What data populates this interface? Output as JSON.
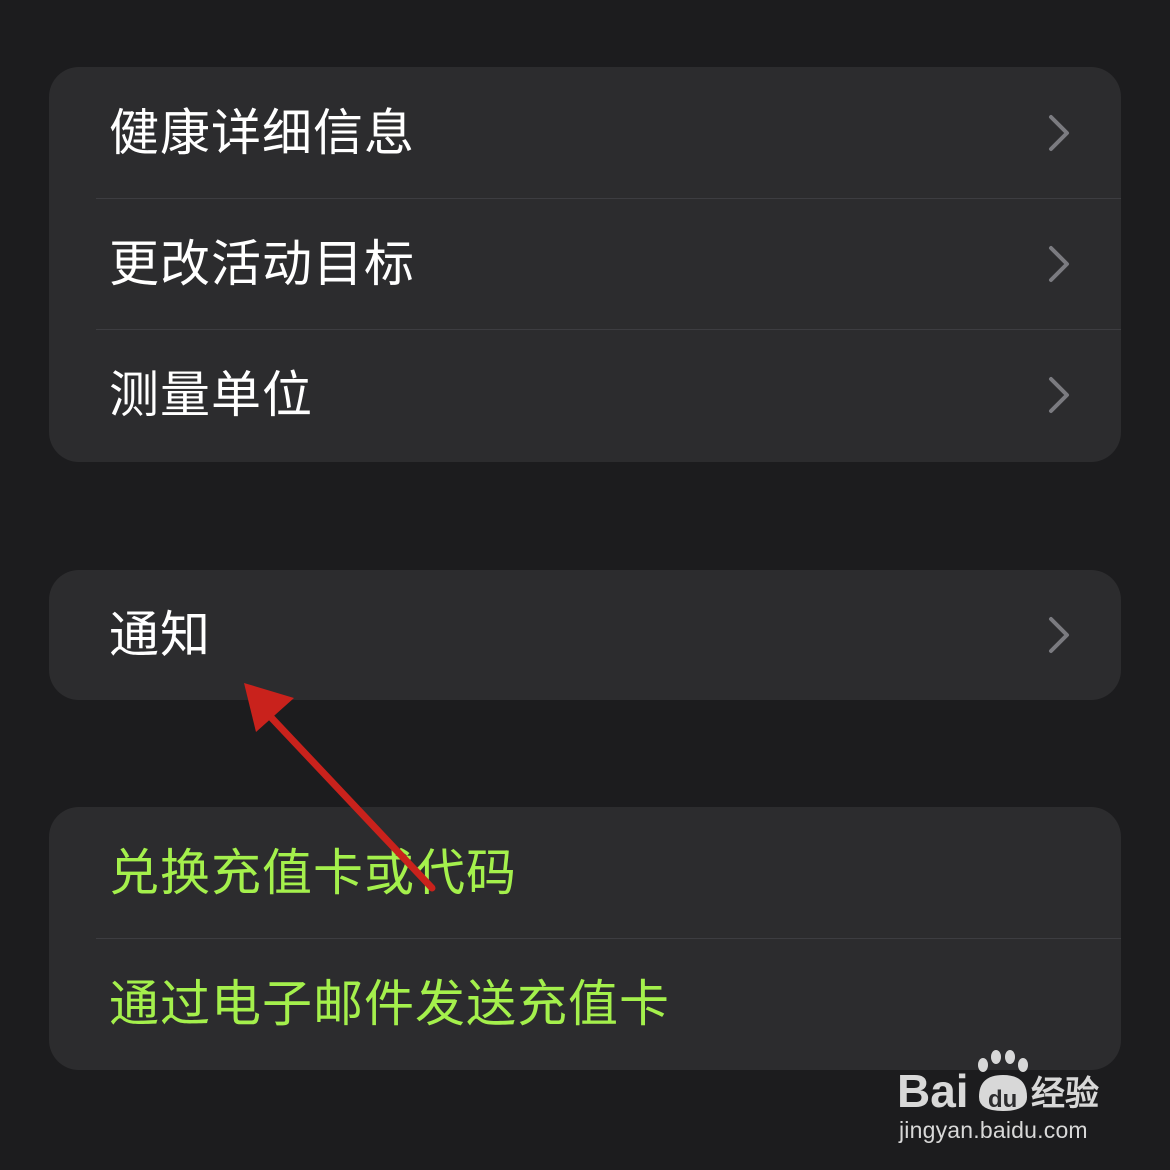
{
  "groups": [
    {
      "items": [
        {
          "label": "健康详细信息",
          "chevron": "chevron-right-icon"
        },
        {
          "label": "更改活动目标",
          "chevron": "chevron-right-icon"
        },
        {
          "label": "测量单位",
          "chevron": "chevron-right-icon"
        }
      ]
    },
    {
      "items": [
        {
          "label": "通知",
          "chevron": "chevron-right-icon"
        }
      ]
    },
    {
      "items": [
        {
          "label": "兑换充值卡或代码"
        },
        {
          "label": "通过电子邮件发送充值卡"
        }
      ]
    }
  ],
  "watermark": {
    "url": "jingyan.baidu.com",
    "logo_text": "Baidu经验"
  },
  "colors": {
    "background": "#1c1c1e",
    "cell": "#2c2c2e",
    "separator": "#3d3d41",
    "link_green": "#a4f04c",
    "chevron": "#7b7b80",
    "annotation_red": "#c9221c"
  }
}
